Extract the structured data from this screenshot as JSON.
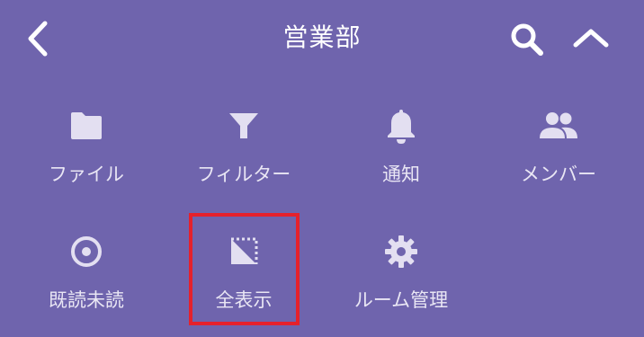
{
  "header": {
    "title": "営業部",
    "back_icon": "chevron-left-icon",
    "search_icon": "search-icon",
    "collapse_icon": "chevron-up-icon"
  },
  "menu": {
    "row1": [
      {
        "label": "ファイル",
        "icon": "folder-icon"
      },
      {
        "label": "フィルター",
        "icon": "filter-icon"
      },
      {
        "label": "通知",
        "icon": "bell-icon"
      },
      {
        "label": "メンバー",
        "icon": "members-icon"
      }
    ],
    "row2": [
      {
        "label": "既読未読",
        "icon": "radio-target-icon"
      },
      {
        "label": "全表示",
        "icon": "select-all-icon"
      },
      {
        "label": "ルーム管理",
        "icon": "gear-icon"
      }
    ]
  },
  "colors": {
    "background": "#6f64ad",
    "icon": "#e3dff1",
    "text": "#e9e6f4",
    "highlight_border": "#e5212c"
  }
}
